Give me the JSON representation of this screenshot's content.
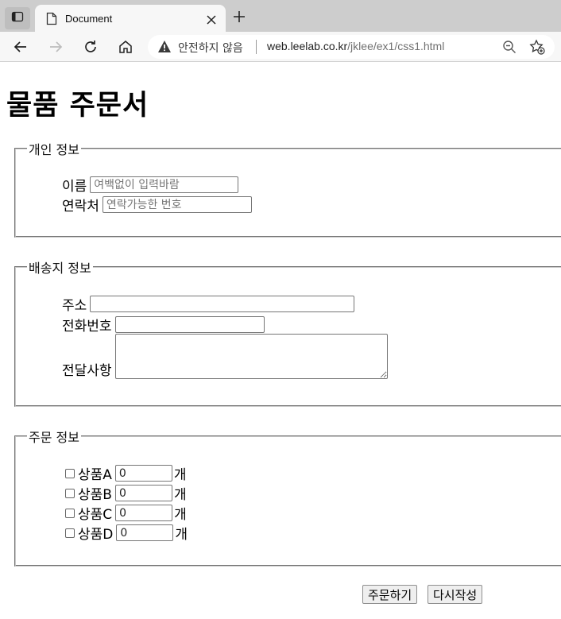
{
  "browser": {
    "tab_title": "Document",
    "security_label": "안전하지 않음",
    "url_host": "web.leelab.co.kr",
    "url_path": "/jklee/ex1/css1.html"
  },
  "page": {
    "title": "물품 주문서",
    "personal": {
      "legend": "개인 정보",
      "name_label": "이름",
      "name_placeholder": "여백없이 입력바람",
      "contact_label": "연락처",
      "contact_placeholder": "연락가능한 번호"
    },
    "shipping": {
      "legend": "배송지 정보",
      "address_label": "주소",
      "phone_label": "전화번호",
      "memo_label": "전달사항"
    },
    "order": {
      "legend": "주문 정보",
      "unit": "개",
      "items": [
        {
          "label": "상품A",
          "qty": "0"
        },
        {
          "label": "상품B",
          "qty": "0"
        },
        {
          "label": "상품C",
          "qty": "0"
        },
        {
          "label": "상품D",
          "qty": "0"
        }
      ]
    },
    "buttons": {
      "submit": "주문하기",
      "reset": "다시작성"
    }
  }
}
